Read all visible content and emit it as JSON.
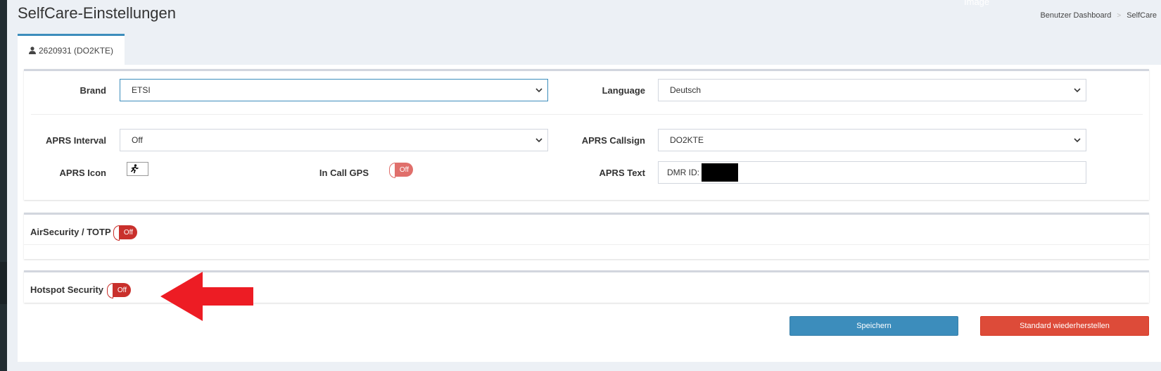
{
  "page": {
    "title": "SelfCare-Einstellungen",
    "ghost_label": "Image"
  },
  "breadcrumb": {
    "items": [
      "Benutzer Dashboard",
      "SelfCare"
    ],
    "separator": ">"
  },
  "tab": {
    "label": "2620931 (DO2KTE)",
    "icon": "user-icon"
  },
  "settings": {
    "brand": {
      "label": "Brand",
      "value": "ETSI"
    },
    "language": {
      "label": "Language",
      "value": "Deutsch"
    },
    "aprs_interval": {
      "label": "APRS Interval",
      "value": "Off"
    },
    "aprs_callsign": {
      "label": "APRS Callsign",
      "value": "DO2KTE"
    },
    "aprs_icon": {
      "label": "APRS Icon",
      "icon": "running-person-icon"
    },
    "in_call_gps": {
      "label": "In Call GPS",
      "state": "Off"
    },
    "aprs_text": {
      "label": "APRS Text",
      "value": "DMR ID:"
    }
  },
  "air_security": {
    "label": "AirSecurity / TOTP",
    "state": "Off"
  },
  "hotspot_security": {
    "label": "Hotspot Security",
    "state": "Off"
  },
  "buttons": {
    "save": "Speichern",
    "reset": "Standard wiederherstellen"
  },
  "colors": {
    "accent": "#3c8dbc",
    "danger": "#dd4b39",
    "toggle_off": "#c9302c",
    "annotation_arrow": "#ed1c24"
  }
}
